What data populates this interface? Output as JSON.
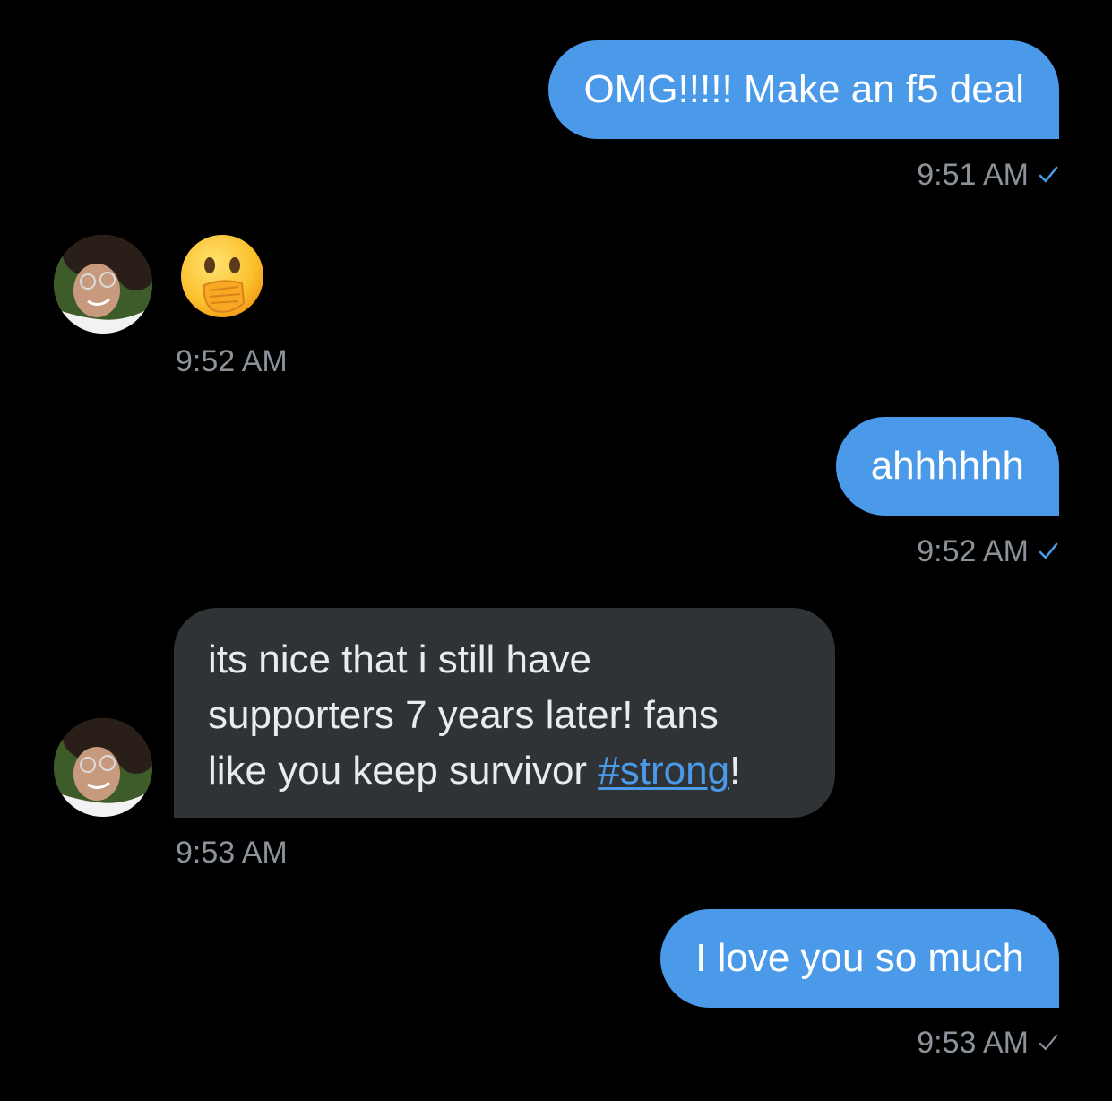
{
  "messages": [
    {
      "id": "m1",
      "direction": "out",
      "text": "OMG!!!!! Make an f5 deal",
      "time": "9:51 AM",
      "receipt": "read"
    },
    {
      "id": "m2",
      "direction": "in",
      "emoji": "face-with-hand-over-mouth",
      "time": "9:52 AM"
    },
    {
      "id": "m3",
      "direction": "out",
      "text": "ahhhhhh",
      "time": "9:52 AM",
      "receipt": "read"
    },
    {
      "id": "m4",
      "direction": "in",
      "lines": [
        "its nice that i still have",
        "supporters 7 years later! fans",
        "like you keep survivor "
      ],
      "hashtag": "#strong",
      "trailing": "!",
      "time": "9:53 AM"
    },
    {
      "id": "m5",
      "direction": "out",
      "text": "I love you so much",
      "time": "9:53 AM",
      "receipt": "sent"
    }
  ],
  "colors": {
    "background": "#000000",
    "outgoing_bubble": "#4a9ae9",
    "incoming_bubble": "#2f3336",
    "timestamp": "#8b9299",
    "read_check": "#4a9ae9",
    "sent_check": "#8b9299",
    "hashtag": "#4a9ae9"
  },
  "icons": {
    "read_receipt": "checkmark-icon",
    "sent_receipt": "checkmark-icon",
    "avatar": "avatar",
    "emoji": "face-with-hand-over-mouth-emoji"
  }
}
